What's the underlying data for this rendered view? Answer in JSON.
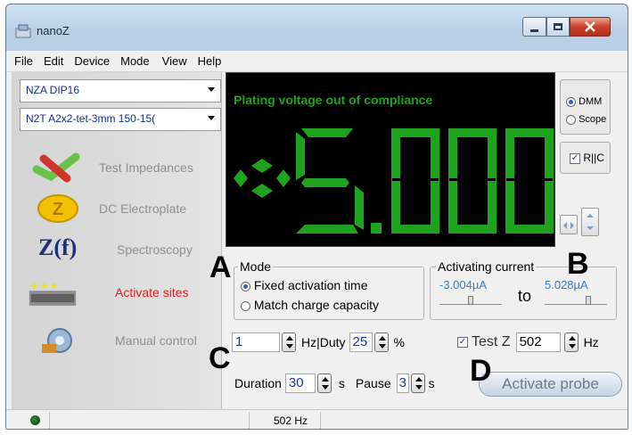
{
  "window": {
    "title": "nanoZ"
  },
  "menu": [
    "File",
    "Edit",
    "Device",
    "Mode",
    "View",
    "Help"
  ],
  "left_panel": {
    "device_combo": "NZA DIP16",
    "probe_combo": "N2T A2x2-tet-3mm 150-15(",
    "nav": [
      {
        "label": "Test Impedances",
        "icon": "test-impedance-icon"
      },
      {
        "label": "DC Electroplate",
        "icon": "electroplate-icon"
      },
      {
        "label": "Spectroscopy",
        "icon": "spectroscopy-icon",
        "icon_text": "Z(f)"
      },
      {
        "label": "Activate sites",
        "icon": "activate-sites-icon",
        "active": true
      },
      {
        "label": "Manual control",
        "icon": "manual-control-icon"
      }
    ]
  },
  "display": {
    "status": "Plating voltage out of compliance",
    "reading_sign": "+",
    "reading_value": "5.000",
    "color": "#1fa31f"
  },
  "display_options": {
    "dmm": "DMM",
    "scope": "Scope",
    "rc": "R||C"
  },
  "mode": {
    "title": "Mode",
    "options": [
      "Fixed activation time",
      "Match charge capacity"
    ],
    "selected": 0
  },
  "current": {
    "title": "Activating current",
    "min": "-3.004µA",
    "to": "to",
    "max": "5.028µA"
  },
  "freq": {
    "hz_value": "1",
    "hz_duty_label": "Hz|Duty",
    "duty_value": "25",
    "pct": "%",
    "test_z_label": "Test Z",
    "test_z_value": "502",
    "test_z_unit": "Hz"
  },
  "duration": {
    "label": "Duration",
    "value": "30",
    "unit": "s",
    "pause_label": "Pause",
    "pause_value": "3",
    "pause_unit": "s"
  },
  "activate_button": "Activate probe",
  "annotations": {
    "a": "A",
    "b": "B",
    "c": "C",
    "d": "D"
  },
  "status_bar": {
    "freq": "502 Hz"
  }
}
